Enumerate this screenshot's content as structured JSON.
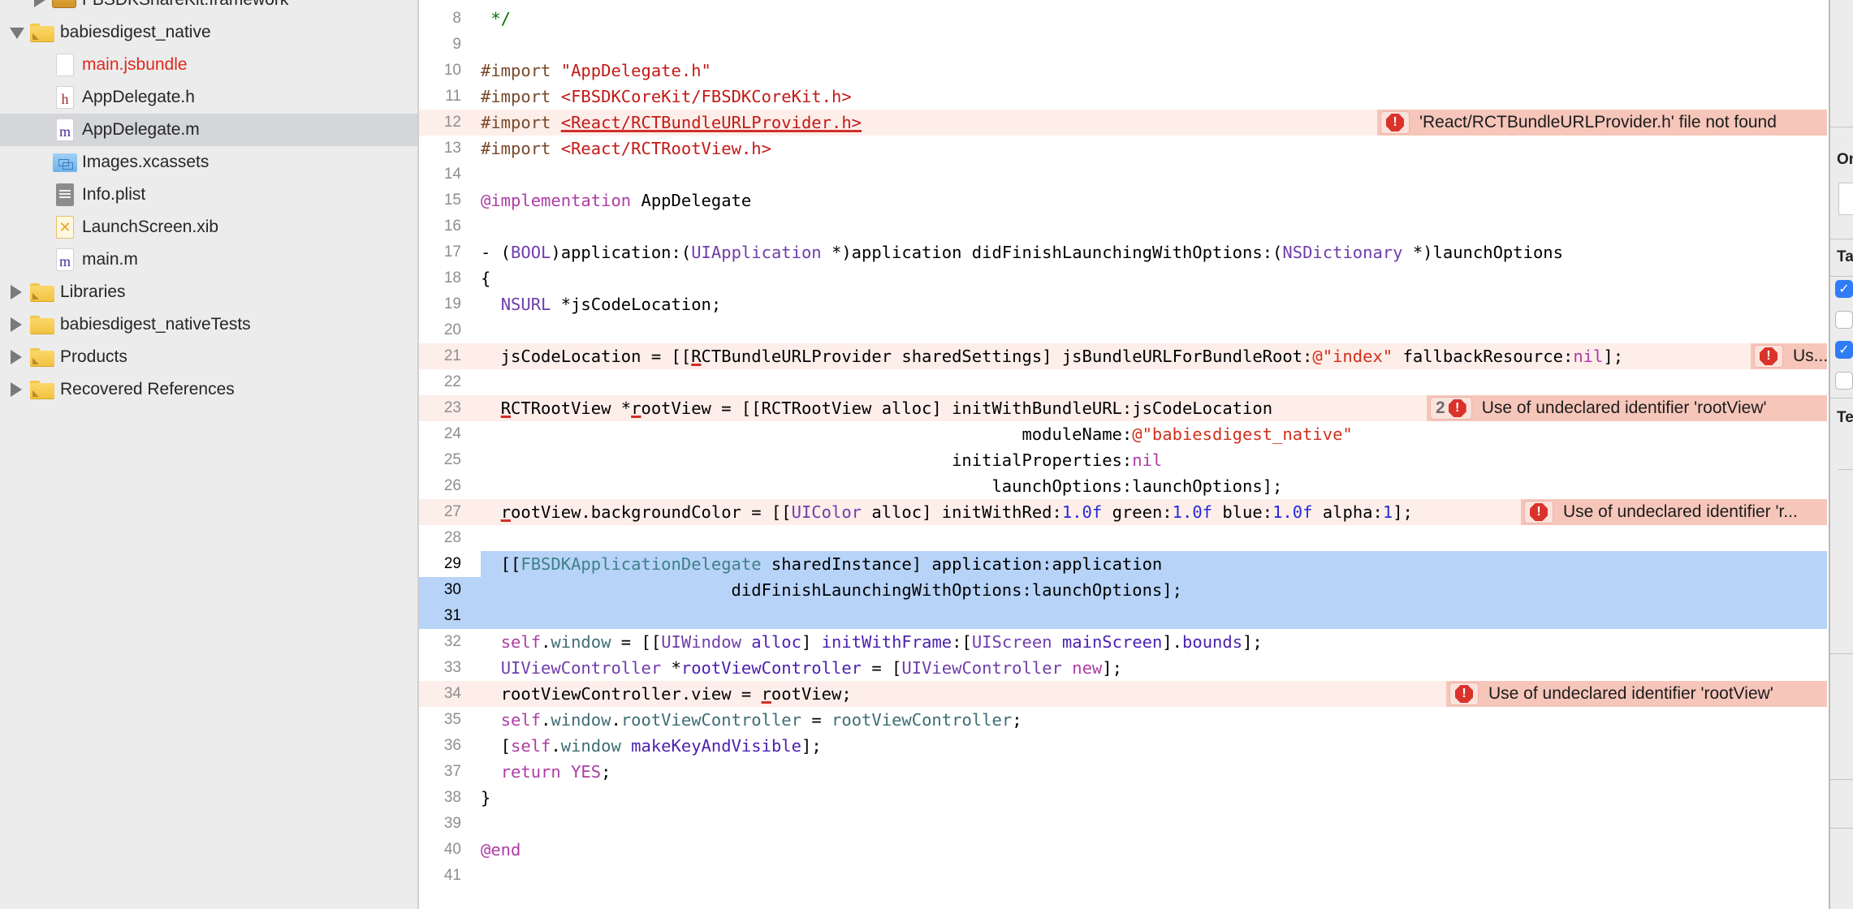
{
  "navigator": {
    "items": [
      {
        "label": "FBSDKShareKit.framework",
        "kind": "framework",
        "expanded": false,
        "depth": 1
      },
      {
        "label": "babiesdigest_native",
        "kind": "group",
        "expanded": true,
        "depth": 0
      },
      {
        "label": "main.jsbundle",
        "kind": "file",
        "icon": "blank-file-icon",
        "missing": true,
        "depth": 1
      },
      {
        "label": "AppDelegate.h",
        "kind": "file",
        "icon": "h-file-icon",
        "glyph": "h",
        "depth": 1
      },
      {
        "label": "AppDelegate.m",
        "kind": "file",
        "icon": "m-file-icon",
        "glyph": "m",
        "selected": true,
        "depth": 1
      },
      {
        "label": "Images.xcassets",
        "kind": "assets",
        "icon": "asset-catalog-icon",
        "depth": 1
      },
      {
        "label": "Info.plist",
        "kind": "file",
        "icon": "plist-file-icon",
        "depth": 1
      },
      {
        "label": "LaunchScreen.xib",
        "kind": "file",
        "icon": "xib-file-icon",
        "depth": 1
      },
      {
        "label": "main.m",
        "kind": "file",
        "icon": "m-file-icon",
        "glyph": "m",
        "depth": 1
      },
      {
        "label": "Libraries",
        "kind": "group",
        "expanded": false,
        "depth": 0
      },
      {
        "label": "babiesdigest_nativeTests",
        "kind": "group",
        "expanded": false,
        "depth": 0
      },
      {
        "label": "Products",
        "kind": "group",
        "expanded": false,
        "depth": 0
      },
      {
        "label": "Recovered References",
        "kind": "group",
        "expanded": false,
        "depth": 0
      }
    ]
  },
  "editor": {
    "file": "AppDelegate.m",
    "lines": [
      {
        "n": "8",
        "code": " */"
      },
      {
        "n": "9",
        "code": ""
      },
      {
        "n": "10",
        "code": "#import \"AppDelegate.h\""
      },
      {
        "n": "11",
        "code": "#import <FBSDKCoreKit/FBSDKCoreKit.h>"
      },
      {
        "n": "12",
        "code": "#import <React/RCTBundleURLProvider.h>",
        "error": "'React/RCTBundleURLProvider.h' file not found"
      },
      {
        "n": "13",
        "code": "#import <React/RCTRootView.h>"
      },
      {
        "n": "14",
        "code": ""
      },
      {
        "n": "15",
        "code": "@implementation AppDelegate"
      },
      {
        "n": "16",
        "code": ""
      },
      {
        "n": "17",
        "code": "- (BOOL)application:(UIApplication *)application didFinishLaunchingWithOptions:(NSDictionary *)launchOptions"
      },
      {
        "n": "18",
        "code": "{"
      },
      {
        "n": "19",
        "code": "  NSURL *jsCodeLocation;"
      },
      {
        "n": "20",
        "code": ""
      },
      {
        "n": "21",
        "code": "  jsCodeLocation = [[RCTBundleURLProvider sharedSettings] jsBundleURLForBundleRoot:@\"index\" fallbackResource:nil];",
        "error": "Us..."
      },
      {
        "n": "22",
        "code": ""
      },
      {
        "n": "23",
        "code": "  RCTRootView *rootView = [[RCTRootView alloc] initWithBundleURL:jsCodeLocation",
        "error": "Use of undeclared identifier 'rootView'",
        "error_count": "2"
      },
      {
        "n": "24",
        "code": "                                                      moduleName:@\"babiesdigest_native\""
      },
      {
        "n": "25",
        "code": "                                               initialProperties:nil"
      },
      {
        "n": "26",
        "code": "                                                   launchOptions:launchOptions];"
      },
      {
        "n": "27",
        "code": "  rootView.backgroundColor = [[UIColor alloc] initWithRed:1.0f green:1.0f blue:1.0f alpha:1];",
        "error": "Use of undeclared identifier 'r..."
      },
      {
        "n": "28",
        "code": ""
      },
      {
        "n": "29",
        "code": "  [[FBSDKApplicationDelegate sharedInstance] application:application",
        "selected": true
      },
      {
        "n": "30",
        "code": "                         didFinishLaunchingWithOptions:launchOptions];",
        "selected": true
      },
      {
        "n": "31",
        "code": "",
        "selected": true
      },
      {
        "n": "32",
        "code": "  self.window = [[UIWindow alloc] initWithFrame:[UIScreen mainScreen].bounds];"
      },
      {
        "n": "33",
        "code": "  UIViewController *rootViewController = [UIViewController new];"
      },
      {
        "n": "34",
        "code": "  rootViewController.view = rootView;",
        "error": "Use of undeclared identifier 'rootView'"
      },
      {
        "n": "35",
        "code": "  self.window.rootViewController = rootViewController;"
      },
      {
        "n": "36",
        "code": "  [self.window makeKeyAndVisible];"
      },
      {
        "n": "37",
        "code": "  return YES;"
      },
      {
        "n": "38",
        "code": "}"
      },
      {
        "n": "39",
        "code": ""
      },
      {
        "n": "40",
        "code": "@end"
      },
      {
        "n": "41",
        "code": ""
      }
    ]
  },
  "inspector": {
    "sections": [
      {
        "title": "On"
      },
      {
        "title": "Ta"
      },
      {
        "title": "Te"
      }
    ],
    "checkboxes": [
      true,
      false,
      true,
      false
    ]
  },
  "colors": {
    "error_line_bg": "#fdeeea",
    "error_badge_bg": "#f6c6ba",
    "selection_bg": "#b7d3f8",
    "error_icon": "#d9332b",
    "checkbox_on": "#2f7cf6"
  }
}
